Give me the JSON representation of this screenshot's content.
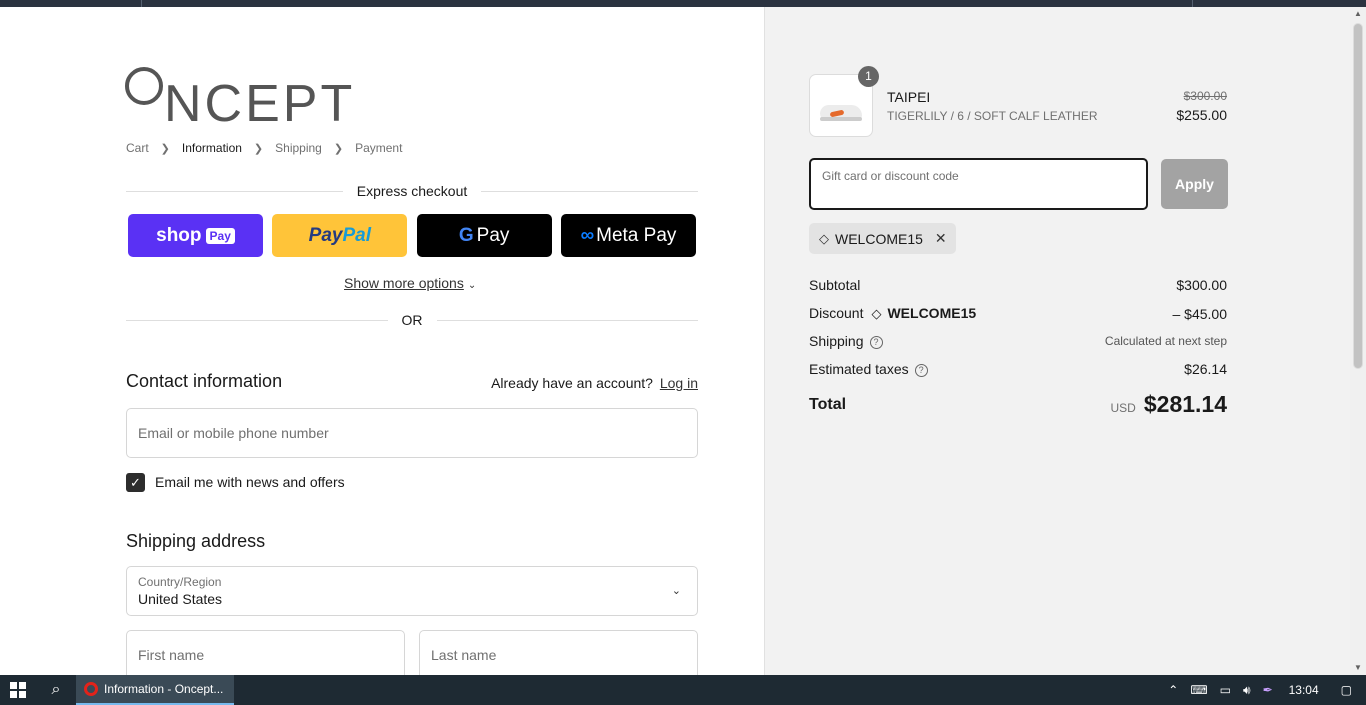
{
  "logo": {
    "text": "NCEPT"
  },
  "breadcrumb": {
    "cart": "Cart",
    "information": "Information",
    "shipping": "Shipping",
    "payment": "Payment"
  },
  "express": {
    "label": "Express checkout",
    "shop_pay": "shop",
    "shop_pay_box": "Pay",
    "paypal_a": "Pay",
    "paypal_b": "Pal",
    "gpay_g": "G",
    "gpay_text": "Pay",
    "meta_text": "Meta Pay",
    "more_options": "Show more options",
    "or": "OR"
  },
  "contact": {
    "heading": "Contact information",
    "account_text": "Already have an account?",
    "login_link": "Log in",
    "email_placeholder": "Email or mobile phone number",
    "newsletter_label": "Email me with news and offers",
    "newsletter_checked": true
  },
  "shipping": {
    "heading": "Shipping address",
    "country_label": "Country/Region",
    "country_value": "United States",
    "first_name_placeholder": "First name",
    "last_name_placeholder": "Last name"
  },
  "summary": {
    "product": {
      "quantity": "1",
      "name": "TAIPEI",
      "variant": "TIGERLILY / 6 / SOFT CALF LEATHER",
      "original_price": "$300.00",
      "price": "$255.00"
    },
    "discount_placeholder": "Gift card or discount code",
    "apply_label": "Apply",
    "applied_code": "WELCOME15",
    "subtotal_label": "Subtotal",
    "subtotal_value": "$300.00",
    "discount_label": "Discount",
    "discount_code": "WELCOME15",
    "discount_value": "– $45.00",
    "shipping_label": "Shipping",
    "shipping_value": "Calculated at next step",
    "taxes_label": "Estimated taxes",
    "taxes_value": "$26.14",
    "total_label": "Total",
    "currency": "USD",
    "total_value": "$281.14"
  },
  "taskbar": {
    "window_title": "Information - Oncept...",
    "clock": "13:04"
  },
  "colors": {
    "shop_pay": "#5a31f4",
    "paypal": "#ffc439",
    "apply_disabled": "#a3a3a3",
    "summary_bg": "#f2f2f2"
  }
}
